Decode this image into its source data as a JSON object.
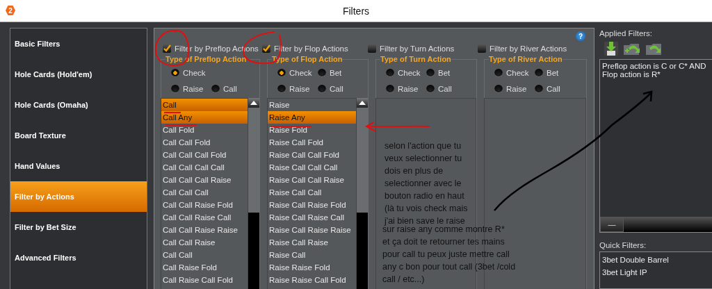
{
  "window": {
    "logo": "2",
    "title": "Filters"
  },
  "sidebar": {
    "items": [
      {
        "label": "Basic Filters",
        "selected": false
      },
      {
        "label": "Hole Cards (Hold'em)",
        "selected": false
      },
      {
        "label": "Hole Cards (Omaha)",
        "selected": false
      },
      {
        "label": "Board Texture",
        "selected": false
      },
      {
        "label": "Hand Values",
        "selected": false
      },
      {
        "label": "Filter by Actions",
        "selected": true
      },
      {
        "label": "Filter by Bet Size",
        "selected": false
      },
      {
        "label": "Advanced Filters",
        "selected": false
      }
    ]
  },
  "help_icon": "?",
  "filters": [
    {
      "label": "Filter by Preflop Actions",
      "checked": true,
      "group_title": "Type of Preflop Action",
      "radios": [
        {
          "label": "Check",
          "selected": true
        },
        {
          "label": "Raise",
          "selected": false
        },
        {
          "label": "Call",
          "selected": false
        }
      ],
      "items": [
        {
          "label": "Call",
          "selected": true
        },
        {
          "label": "Call Any",
          "selected": true
        },
        {
          "label": "Call Fold",
          "selected": false
        },
        {
          "label": "Call Call Fold",
          "selected": false
        },
        {
          "label": "Call Call Call Fold",
          "selected": false
        },
        {
          "label": "Call Call Call Call",
          "selected": false
        },
        {
          "label": "Call Call Call Raise",
          "selected": false
        },
        {
          "label": "Call Call Call",
          "selected": false
        },
        {
          "label": "Call Call Raise Fold",
          "selected": false
        },
        {
          "label": "Call Call Raise Call",
          "selected": false
        },
        {
          "label": "Call Call Raise Raise",
          "selected": false
        },
        {
          "label": "Call Call Raise",
          "selected": false
        },
        {
          "label": "Call Call",
          "selected": false
        },
        {
          "label": "Call Raise Fold",
          "selected": false
        },
        {
          "label": "Call Raise Call Fold",
          "selected": false
        }
      ]
    },
    {
      "label": "Filter by Flop Actions",
      "checked": true,
      "group_title": "Type of Flop Action",
      "radios": [
        {
          "label": "Check",
          "selected": true
        },
        {
          "label": "Bet",
          "selected": false
        },
        {
          "label": "Raise",
          "selected": false
        },
        {
          "label": "Call",
          "selected": false
        }
      ],
      "items": [
        {
          "label": "Raise",
          "selected": false
        },
        {
          "label": "Raise Any",
          "selected": true
        },
        {
          "label": "Raise Fold",
          "selected": false
        },
        {
          "label": "Raise Call Fold",
          "selected": false
        },
        {
          "label": "Raise Call Call Fold",
          "selected": false
        },
        {
          "label": "Raise Call Call Call",
          "selected": false
        },
        {
          "label": "Raise Call Call Raise",
          "selected": false
        },
        {
          "label": "Raise Call Call",
          "selected": false
        },
        {
          "label": "Raise Call Raise Fold",
          "selected": false
        },
        {
          "label": "Raise Call Raise Call",
          "selected": false
        },
        {
          "label": "Raise Call Raise Raise",
          "selected": false
        },
        {
          "label": "Raise Call Raise",
          "selected": false
        },
        {
          "label": "Raise Call",
          "selected": false
        },
        {
          "label": "Raise Raise Fold",
          "selected": false
        },
        {
          "label": "Raise Raise Call Fold",
          "selected": false
        }
      ]
    },
    {
      "label": "Filter by Turn Actions",
      "checked": false,
      "group_title": "Type of Turn Action",
      "radios": [
        {
          "label": "Check",
          "selected": false
        },
        {
          "label": "Bet",
          "selected": false
        },
        {
          "label": "Raise",
          "selected": false
        },
        {
          "label": "Call",
          "selected": false
        }
      ]
    },
    {
      "label": "Filter by River Actions",
      "checked": false,
      "group_title": "Type of River Action",
      "radios": [
        {
          "label": "Check",
          "selected": false
        },
        {
          "label": "Bet",
          "selected": false
        },
        {
          "label": "Raise",
          "selected": false
        },
        {
          "label": "Call",
          "selected": false
        }
      ]
    }
  ],
  "applied_filters": {
    "title": "Applied Filters:",
    "text": "Preflop action is C or C* AND\nFlop action is R*",
    "scroll_button": "—"
  },
  "quick_filters": {
    "title": "Quick Filters:",
    "items": [
      "3bet Double Barrel",
      "3bet Light IP"
    ]
  },
  "annotations": [
    "selon l'action que tu\nveux selectionner tu\ndois en plus de\nselectionner avec le\nbouton radio en haut\n(là tu vois check mais\nj'ai bien save le raise",
    "sur raise any comme montre R*\net ça doit te retourner tes mains\npour call tu peux juste mettre call\nany c bon pour tout call (3bet /cold\ncall / etc...)"
  ]
}
